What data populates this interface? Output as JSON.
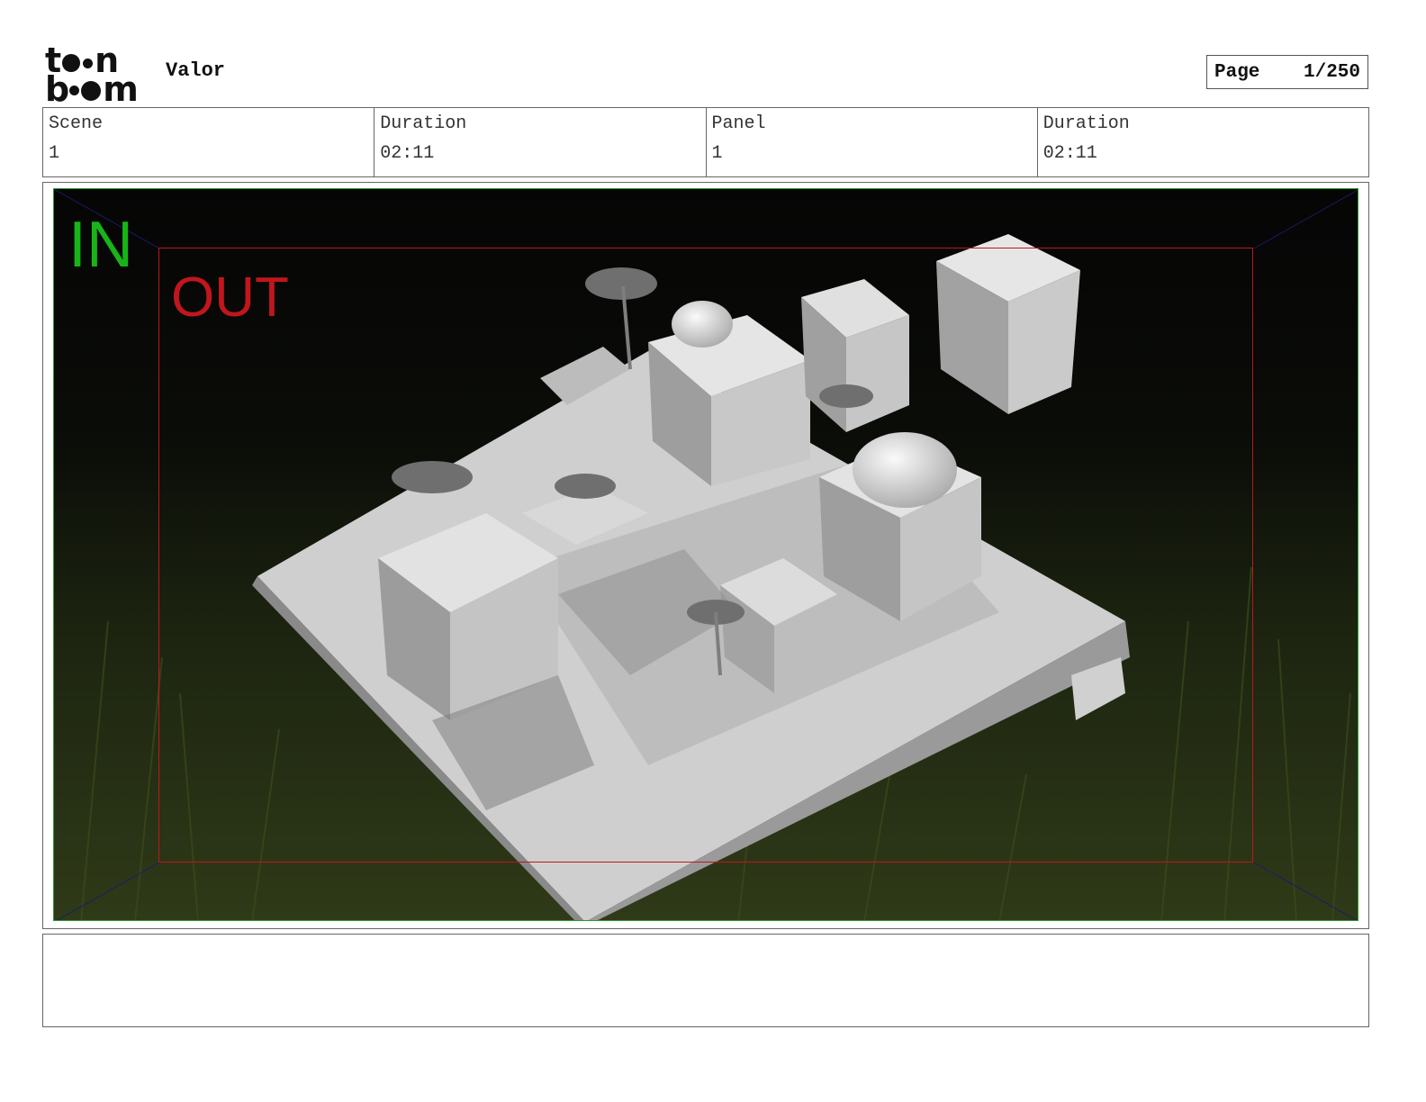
{
  "header": {
    "logo_text": "toonboom",
    "project_title": "Valor",
    "page_label": "Page",
    "page_value": "1/250"
  },
  "info": {
    "scene_label": "Scene",
    "scene_value": "1",
    "scene_duration_label": "Duration",
    "scene_duration_value": "02:11",
    "panel_label": "Panel",
    "panel_value": "1",
    "panel_duration_label": "Duration",
    "panel_duration_value": "02:11"
  },
  "frame": {
    "in_label": "IN",
    "out_label": "OUT",
    "in_color": "#18b418",
    "out_color": "#c0161c"
  },
  "notes": {
    "text": ""
  }
}
